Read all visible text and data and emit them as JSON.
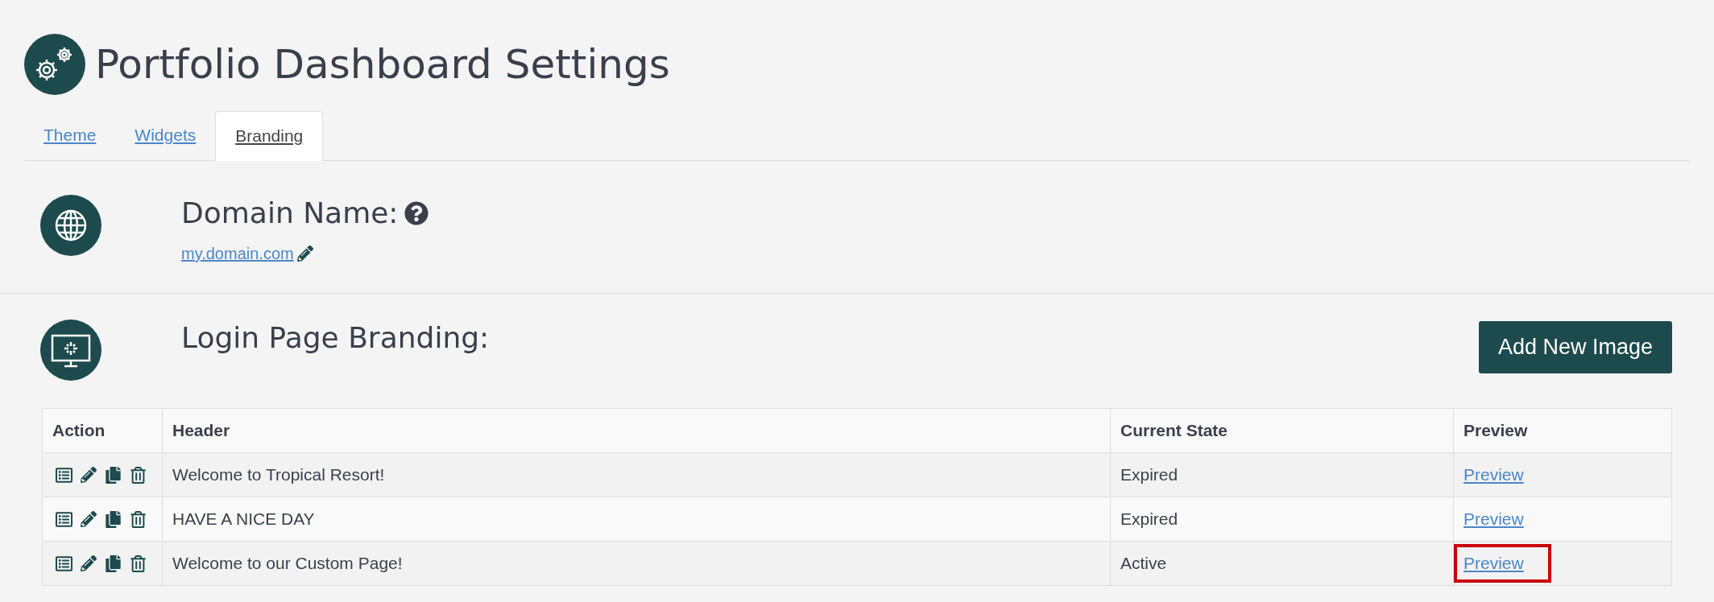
{
  "title": "Portfolio Dashboard Settings",
  "tabs": [
    {
      "label": "Theme",
      "selected": false
    },
    {
      "label": "Widgets",
      "selected": false
    },
    {
      "label": "Branding",
      "selected": true
    }
  ],
  "domain": {
    "heading": "Domain Name:",
    "value": "my.domain.com"
  },
  "branding": {
    "heading": "Login Page Branding:",
    "button": "Add New Image",
    "table": {
      "columns": [
        "Action",
        "Header",
        "Current State",
        "Preview"
      ],
      "rows": [
        {
          "header": "Welcome to Tropical Resort!",
          "state": "Expired",
          "preview": "Preview",
          "highlighted": false
        },
        {
          "header": "HAVE A NICE DAY",
          "state": "Expired",
          "preview": "Preview",
          "highlighted": false
        },
        {
          "header": "Welcome to our Custom Page!",
          "state": "Active",
          "preview": "Preview",
          "highlighted": true
        }
      ]
    }
  }
}
